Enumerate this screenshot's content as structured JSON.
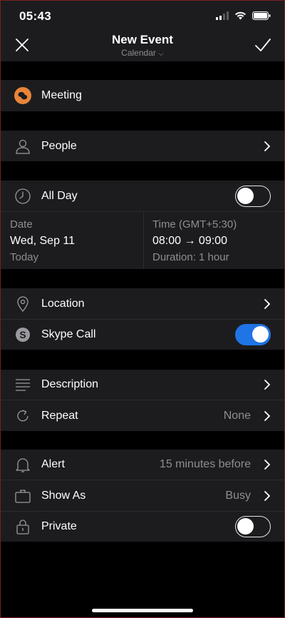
{
  "status_bar": {
    "time": "05:43"
  },
  "nav": {
    "title": "New Event",
    "subtitle": "Calendar",
    "subtitle_chevron": "⌵"
  },
  "rows": {
    "meeting": {
      "label": "Meeting",
      "icon": "meeting-bubble-icon",
      "color": "#e8843a"
    },
    "people": {
      "label": "People",
      "icon": "person-icon"
    },
    "all_day": {
      "label": "All Day",
      "icon": "clock-icon",
      "toggle_on": false
    },
    "location": {
      "label": "Location",
      "icon": "location-pin-icon"
    },
    "skype": {
      "label": "Skype Call",
      "icon": "skype-icon",
      "toggle_on": true
    },
    "description": {
      "label": "Description",
      "icon": "lines-icon"
    },
    "repeat": {
      "label": "Repeat",
      "value": "None",
      "icon": "repeat-icon"
    },
    "alert": {
      "label": "Alert",
      "value": "15 minutes before",
      "icon": "bell-icon"
    },
    "show_as": {
      "label": "Show As",
      "value": "Busy",
      "icon": "briefcase-icon"
    },
    "private": {
      "label": "Private",
      "icon": "lock-icon",
      "toggle_on": false
    }
  },
  "date_time": {
    "date_label": "Date",
    "date_value": "Wed, Sep 11",
    "date_note": "Today",
    "time_label": "Time (GMT+5:30)",
    "time_value": "08:00 → 09:00",
    "duration": "Duration: 1 hour"
  },
  "colors": {
    "accent": "#1f74e6",
    "row_bg": "#1c1c1e",
    "secondary_text": "#8e8e93"
  }
}
